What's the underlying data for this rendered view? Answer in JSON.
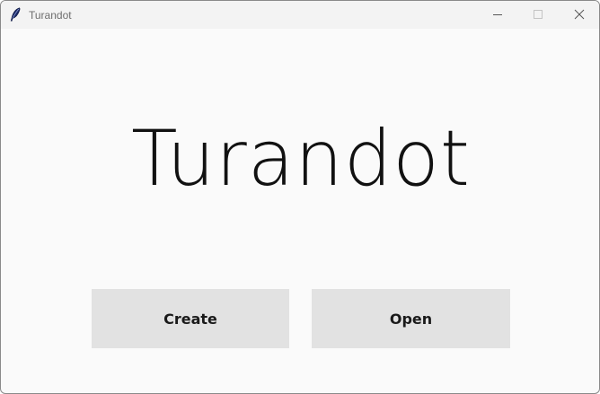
{
  "window": {
    "title": "Turandot",
    "app_icon": "feather-icon",
    "controls": {
      "minimize_icon": "minimize-icon",
      "maximize_icon": "maximize-icon",
      "close_icon": "close-icon"
    }
  },
  "main": {
    "heading": "Turandot",
    "buttons": {
      "create_label": "Create",
      "open_label": "Open"
    }
  },
  "colors": {
    "background": "#fafafa",
    "titlebar": "#f3f3f3",
    "button_bg": "#e2e2e2",
    "text": "#111111"
  }
}
